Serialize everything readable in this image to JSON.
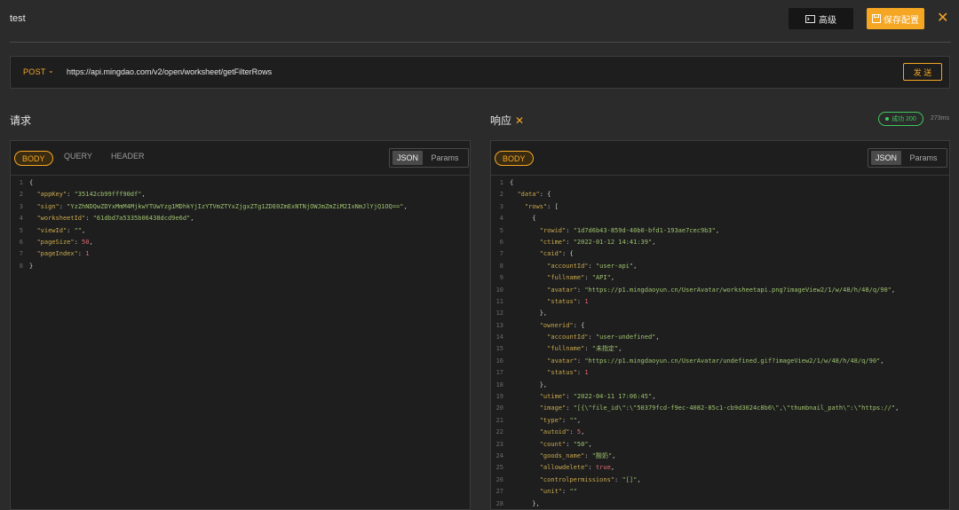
{
  "header": {
    "title": "test",
    "advanced_label": "高级",
    "save_label": "保存配置"
  },
  "request_bar": {
    "method": "POST",
    "url": "https://api.mingdao.com/v2/open/worksheet/getFilterRows",
    "send_label": "发 送"
  },
  "request": {
    "label": "请求",
    "tabs": [
      "BODY",
      "QUERY",
      "HEADER"
    ],
    "format_tabs": [
      "JSON",
      "Params"
    ],
    "lines": [
      [
        [
          "p",
          "{"
        ]
      ],
      [
        [
          "p",
          "  "
        ],
        [
          "k",
          "\"appKey\""
        ],
        [
          "p",
          ": "
        ],
        [
          "s",
          "\"35142cb99fff90df\""
        ],
        [
          "p",
          ","
        ]
      ],
      [
        [
          "p",
          "  "
        ],
        [
          "k",
          "\"sign\""
        ],
        [
          "p",
          ": "
        ],
        [
          "s",
          "\"YzZhNDQwZDYxMmM4MjkwYTUwYzg1MDhkYjIzYTVmZTYxZjgxZTg1ZDE0ZmExNTNjOWJmZmZiM2IxNmJlYjQ1OQ==\""
        ],
        [
          "p",
          ","
        ]
      ],
      [
        [
          "p",
          "  "
        ],
        [
          "k",
          "\"worksheetId\""
        ],
        [
          "p",
          ": "
        ],
        [
          "s",
          "\"61dbd7a5335b06438dcd9e6d\""
        ],
        [
          "p",
          ","
        ]
      ],
      [
        [
          "p",
          "  "
        ],
        [
          "k",
          "\"viewId\""
        ],
        [
          "p",
          ": "
        ],
        [
          "s",
          "\"\""
        ],
        [
          "p",
          ","
        ]
      ],
      [
        [
          "p",
          "  "
        ],
        [
          "k",
          "\"pageSize\""
        ],
        [
          "p",
          ": "
        ],
        [
          "n",
          "50"
        ],
        [
          "p",
          ","
        ]
      ],
      [
        [
          "p",
          "  "
        ],
        [
          "k",
          "\"pageIndex\""
        ],
        [
          "p",
          ": "
        ],
        [
          "n",
          "1"
        ]
      ],
      [
        [
          "p",
          "}"
        ]
      ]
    ]
  },
  "response": {
    "label": "响应",
    "status": "成功 200",
    "time": "273ms",
    "tabs": [
      "BODY"
    ],
    "format_tabs": [
      "JSON",
      "Params"
    ],
    "lines": [
      [
        [
          "p",
          "{"
        ]
      ],
      [
        [
          "p",
          "  "
        ],
        [
          "k",
          "\"data\""
        ],
        [
          "p",
          ": {"
        ]
      ],
      [
        [
          "p",
          "    "
        ],
        [
          "k",
          "\"rows\""
        ],
        [
          "p",
          ": ["
        ]
      ],
      [
        [
          "p",
          "      {"
        ]
      ],
      [
        [
          "p",
          "        "
        ],
        [
          "k",
          "\"rowid\""
        ],
        [
          "p",
          ": "
        ],
        [
          "s",
          "\"1d7d6b43-859d-40b0-bfd1-193ae7cec9b3\""
        ],
        [
          "p",
          ","
        ]
      ],
      [
        [
          "p",
          "        "
        ],
        [
          "k",
          "\"ctime\""
        ],
        [
          "p",
          ": "
        ],
        [
          "s",
          "\"2022-01-12 14:41:39\""
        ],
        [
          "p",
          ","
        ]
      ],
      [
        [
          "p",
          "        "
        ],
        [
          "k",
          "\"caid\""
        ],
        [
          "p",
          ": {"
        ]
      ],
      [
        [
          "p",
          "          "
        ],
        [
          "k",
          "\"accountId\""
        ],
        [
          "p",
          ": "
        ],
        [
          "s",
          "\"user-api\""
        ],
        [
          "p",
          ","
        ]
      ],
      [
        [
          "p",
          "          "
        ],
        [
          "k",
          "\"fullname\""
        ],
        [
          "p",
          ": "
        ],
        [
          "s",
          "\"API\""
        ],
        [
          "p",
          ","
        ]
      ],
      [
        [
          "p",
          "          "
        ],
        [
          "k",
          "\"avatar\""
        ],
        [
          "p",
          ": "
        ],
        [
          "s",
          "\"https://p1.mingdaoyun.cn/UserAvatar/worksheetapi.png?imageView2/1/w/48/h/48/q/90\""
        ],
        [
          "p",
          ","
        ]
      ],
      [
        [
          "p",
          "          "
        ],
        [
          "k",
          "\"status\""
        ],
        [
          "p",
          ": "
        ],
        [
          "n",
          "1"
        ]
      ],
      [
        [
          "p",
          "        },"
        ]
      ],
      [
        [
          "p",
          "        "
        ],
        [
          "k",
          "\"ownerid\""
        ],
        [
          "p",
          ": {"
        ]
      ],
      [
        [
          "p",
          "          "
        ],
        [
          "k",
          "\"accountId\""
        ],
        [
          "p",
          ": "
        ],
        [
          "s",
          "\"user-undefined\""
        ],
        [
          "p",
          ","
        ]
      ],
      [
        [
          "p",
          "          "
        ],
        [
          "k",
          "\"fullname\""
        ],
        [
          "p",
          ": "
        ],
        [
          "s",
          "\"未指定\""
        ],
        [
          "p",
          ","
        ]
      ],
      [
        [
          "p",
          "          "
        ],
        [
          "k",
          "\"avatar\""
        ],
        [
          "p",
          ": "
        ],
        [
          "s",
          "\"https://p1.mingdaoyun.cn/UserAvatar/undefined.gif?imageView2/1/w/48/h/48/q/90\""
        ],
        [
          "p",
          ","
        ]
      ],
      [
        [
          "p",
          "          "
        ],
        [
          "k",
          "\"status\""
        ],
        [
          "p",
          ": "
        ],
        [
          "n",
          "1"
        ]
      ],
      [
        [
          "p",
          "        },"
        ]
      ],
      [
        [
          "p",
          "        "
        ],
        [
          "k",
          "\"utime\""
        ],
        [
          "p",
          ": "
        ],
        [
          "s",
          "\"2022-04-11 17:06:45\""
        ],
        [
          "p",
          ","
        ]
      ],
      [
        [
          "p",
          "        "
        ],
        [
          "k",
          "\"image\""
        ],
        [
          "p",
          ": "
        ],
        [
          "s",
          "\"[{\\\"file_id\\\":\\\"50379fcd-f9ec-4082-85c1-cb9d3024c8b6\\\",\\\"thumbnail_path\\\":\\\"https://\""
        ],
        [
          "p",
          ","
        ]
      ],
      [
        [
          "p",
          "        "
        ],
        [
          "k",
          "\"type\""
        ],
        [
          "p",
          ": "
        ],
        [
          "s",
          "\"\""
        ],
        [
          "p",
          ","
        ]
      ],
      [
        [
          "p",
          "        "
        ],
        [
          "k",
          "\"autoid\""
        ],
        [
          "p",
          ": "
        ],
        [
          "n",
          "5"
        ],
        [
          "p",
          ","
        ]
      ],
      [
        [
          "p",
          "        "
        ],
        [
          "k",
          "\"count\""
        ],
        [
          "p",
          ": "
        ],
        [
          "s",
          "\"50\""
        ],
        [
          "p",
          ","
        ]
      ],
      [
        [
          "p",
          "        "
        ],
        [
          "k",
          "\"goods_name\""
        ],
        [
          "p",
          ": "
        ],
        [
          "s",
          "\"酸奶\""
        ],
        [
          "p",
          ","
        ]
      ],
      [
        [
          "p",
          "        "
        ],
        [
          "k",
          "\"allowdelete\""
        ],
        [
          "p",
          ": "
        ],
        [
          "n",
          "true"
        ],
        [
          "p",
          ","
        ]
      ],
      [
        [
          "p",
          "        "
        ],
        [
          "k",
          "\"controlpermissions\""
        ],
        [
          "p",
          ": "
        ],
        [
          "s",
          "\"[]\""
        ],
        [
          "p",
          ","
        ]
      ],
      [
        [
          "p",
          "        "
        ],
        [
          "k",
          "\"unit\""
        ],
        [
          "p",
          ": "
        ],
        [
          "s",
          "\"\""
        ]
      ],
      [
        [
          "p",
          "      },"
        ]
      ]
    ]
  },
  "colors": {
    "accent": "#f5a623",
    "success": "#3ec95e",
    "key": "#c9a84c",
    "string": "#9ec26e",
    "number": "#e06c75"
  },
  "icons": {
    "advanced": "terminal-icon",
    "save": "save-icon",
    "close": "close-icon",
    "method_dropdown": "chevron-down-icon"
  }
}
